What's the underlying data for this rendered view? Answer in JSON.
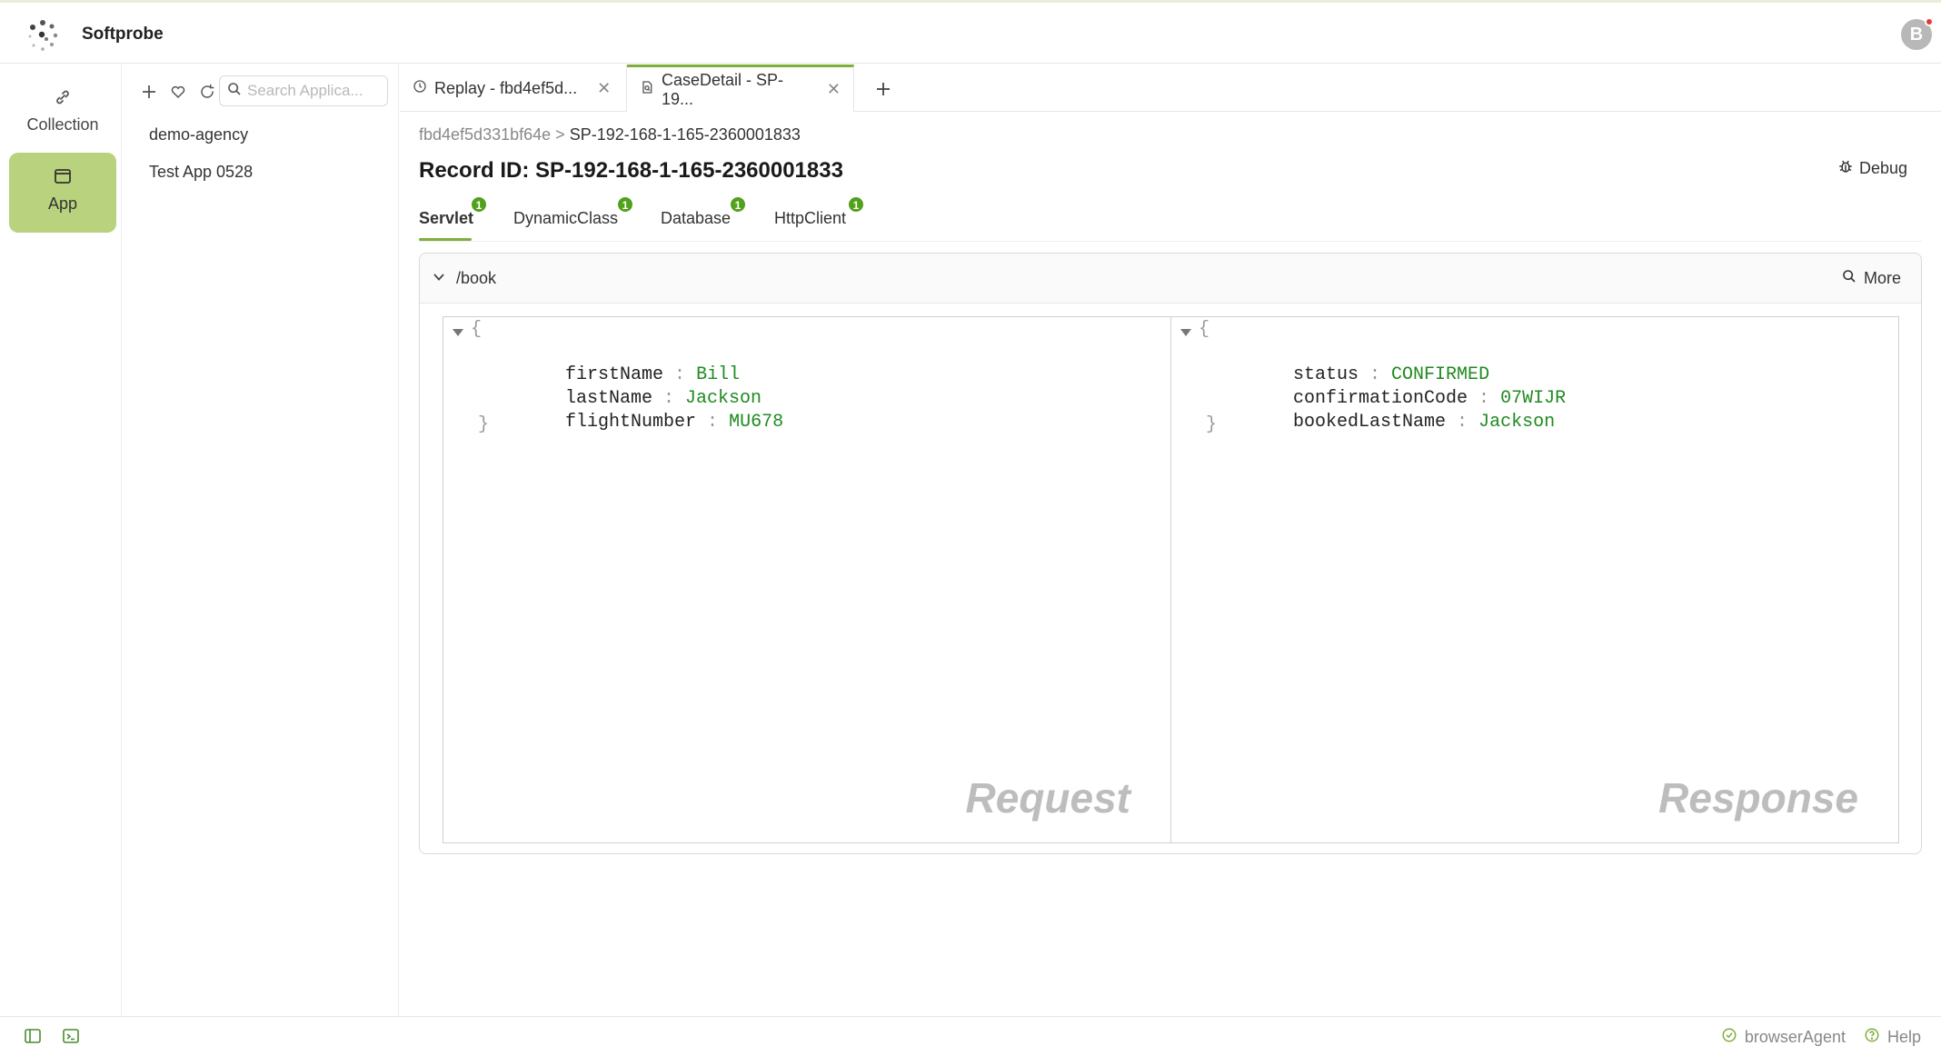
{
  "app": {
    "title": "Softprobe",
    "avatar_initial": "B"
  },
  "rail": {
    "items": [
      {
        "label": "Collection",
        "icon": "link-icon"
      },
      {
        "label": "App",
        "icon": "window-icon"
      }
    ]
  },
  "sidebar": {
    "search_placeholder": "Search Applica...",
    "apps": [
      "demo-agency",
      "Test App 0528"
    ]
  },
  "tabs": [
    {
      "label": "Replay - fbd4ef5d...",
      "icon": "clock-icon"
    },
    {
      "label": "CaseDetail - SP-19...",
      "icon": "document-search-icon"
    }
  ],
  "breadcrumb": {
    "parent": "fbd4ef5d331bf64e",
    "separator": ">",
    "current": "SP-192-168-1-165-2360001833"
  },
  "record": {
    "title": "Record ID: SP-192-168-1-165-2360001833",
    "debug_label": "Debug"
  },
  "subtabs": [
    {
      "label": "Servlet",
      "count": "1"
    },
    {
      "label": "DynamicClass",
      "count": "1"
    },
    {
      "label": "Database",
      "count": "1"
    },
    {
      "label": "HttpClient",
      "count": "1"
    }
  ],
  "panel": {
    "path": "/book",
    "more_label": "More",
    "request": {
      "open_brace": "{",
      "close_brace": "}",
      "fields": [
        {
          "key": "firstName",
          "value": "Bill"
        },
        {
          "key": "lastName",
          "value": "Jackson"
        },
        {
          "key": "flightNumber",
          "value": "MU678"
        }
      ],
      "watermark": "Request"
    },
    "response": {
      "open_brace": "{",
      "close_brace": "}",
      "fields": [
        {
          "key": "status",
          "value": "CONFIRMED"
        },
        {
          "key": "confirmationCode",
          "value": "07WIJR"
        },
        {
          "key": "bookedLastName",
          "value": "Jackson"
        }
      ],
      "watermark": "Response"
    }
  },
  "footer": {
    "agent_label": "browserAgent",
    "help_label": "Help"
  },
  "colors": {
    "accent": "#7fae3a",
    "active_nav": "#b8d27e",
    "badge": "#52a11d",
    "json_value": "#1f8a1f"
  }
}
